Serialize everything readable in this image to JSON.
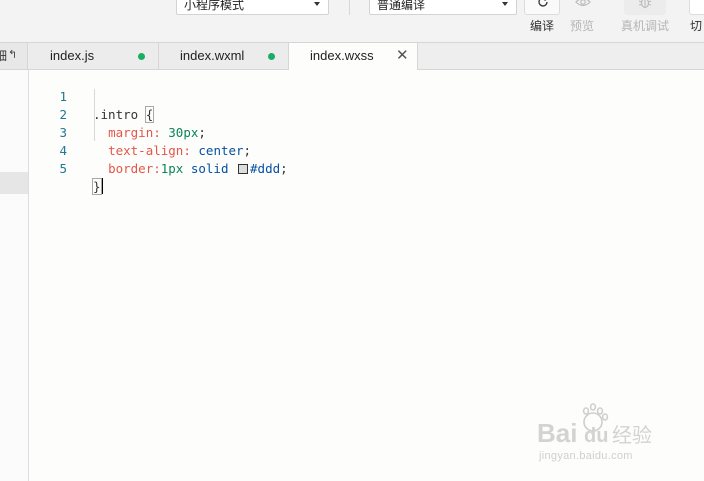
{
  "toolbar": {
    "mode_select": {
      "value": "小程序模式"
    },
    "compile_select": {
      "value": "普通编译"
    },
    "buttons": {
      "compile": "编译",
      "preview": "预览",
      "remote_debug": "真机调试",
      "switch_backend": "切"
    },
    "icons": {
      "compile": "refresh-icon",
      "preview": "eye-icon",
      "remote_debug": "bug-icon"
    }
  },
  "sidebar_tab": {
    "label": "细",
    "icon": "collapse-arrow-icon",
    "arrow": "↰"
  },
  "tabs": [
    {
      "label": "index.js",
      "modified": true
    },
    {
      "label": "index.wxml",
      "modified": true
    },
    {
      "label": "index.wxss",
      "active": true,
      "close": "✕"
    }
  ],
  "editor": {
    "line_numbers": [
      "1",
      "2",
      "3",
      "4",
      "5"
    ],
    "lines": {
      "l1": {
        "selector": ".intro",
        "brace": "{"
      },
      "l2": {
        "prop": "margin",
        "colon": ":",
        "num": "30px",
        "end": ";"
      },
      "l3": {
        "prop": "text-align",
        "colon": ":",
        "val": "center",
        "end": ";"
      },
      "l4": {
        "prop": "border",
        "colon": ":",
        "num": "1px",
        "val": "solid",
        "color": "#ddd",
        "end": ";"
      },
      "l5": {
        "brace": "}"
      }
    },
    "swatch_color": "#dddddd"
  },
  "watermark": {
    "logo": "Bai du 经验",
    "url": "jingyan.baidu.com"
  },
  "colors": {
    "accent_green": "#1aad63",
    "line_number": "#237893",
    "css_property": "#e45649",
    "css_number": "#098658",
    "css_value": "#0451a5"
  }
}
